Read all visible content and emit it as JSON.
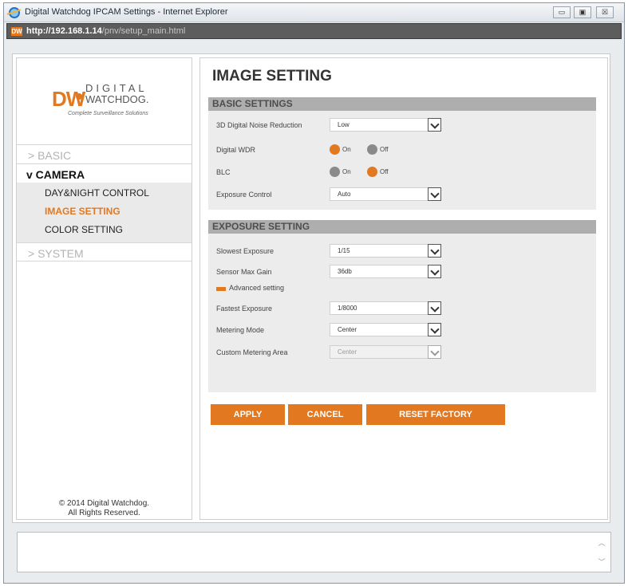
{
  "window": {
    "title": "Digital Watchdog IPCAM Settings - Internet Explorer",
    "minimize": "▭",
    "maximize": "▣",
    "close": "☒"
  },
  "address": {
    "host": "http://192.168.1.14",
    "path": "/pnv/setup_main.html"
  },
  "logo": {
    "mark": "DW",
    "line1": "DIGITAL",
    "line2": "WATCHDOG.",
    "tagline": "Complete Surveillance Solutions"
  },
  "sidebar": {
    "basic": "> BASIC",
    "camera": "v CAMERA",
    "items": [
      "DAY&NIGHT CONTROL",
      "IMAGE SETTING",
      "COLOR SETTING"
    ],
    "system": "> SYSTEM",
    "copyright1": "© 2014 Digital Watchdog.",
    "copyright2": "All Rights Reserved."
  },
  "main": {
    "title": "IMAGE SETTING",
    "basic": {
      "header": "BASIC SETTINGS",
      "noise_label": "3D Digital Noise Reduction",
      "noise_value": "Low",
      "wdr_label": "Digital WDR",
      "blc_label": "BLC",
      "on": "On",
      "off": "Off",
      "exposure_label": "Exposure Control",
      "exposure_value": "Auto"
    },
    "exposure": {
      "header": "EXPOSURE SETTING",
      "slowest_label": "Slowest Exposure",
      "slowest_value": "1/15",
      "gain_label": "Sensor Max Gain",
      "gain_value": "36db",
      "advanced_label": "Advanced setting",
      "fastest_label": "Fastest Exposure",
      "fastest_value": "1/8000",
      "metering_label": "Metering Mode",
      "metering_value": "Center",
      "custom_label": "Custom Metering Area",
      "custom_value": "Center"
    },
    "buttons": {
      "apply": "APPLY",
      "cancel": "CANCEL",
      "reset": "RESET FACTORY"
    }
  },
  "colors": {
    "accent": "#e2781f",
    "section_header": "#aeaeae",
    "panel": "#ececec"
  }
}
